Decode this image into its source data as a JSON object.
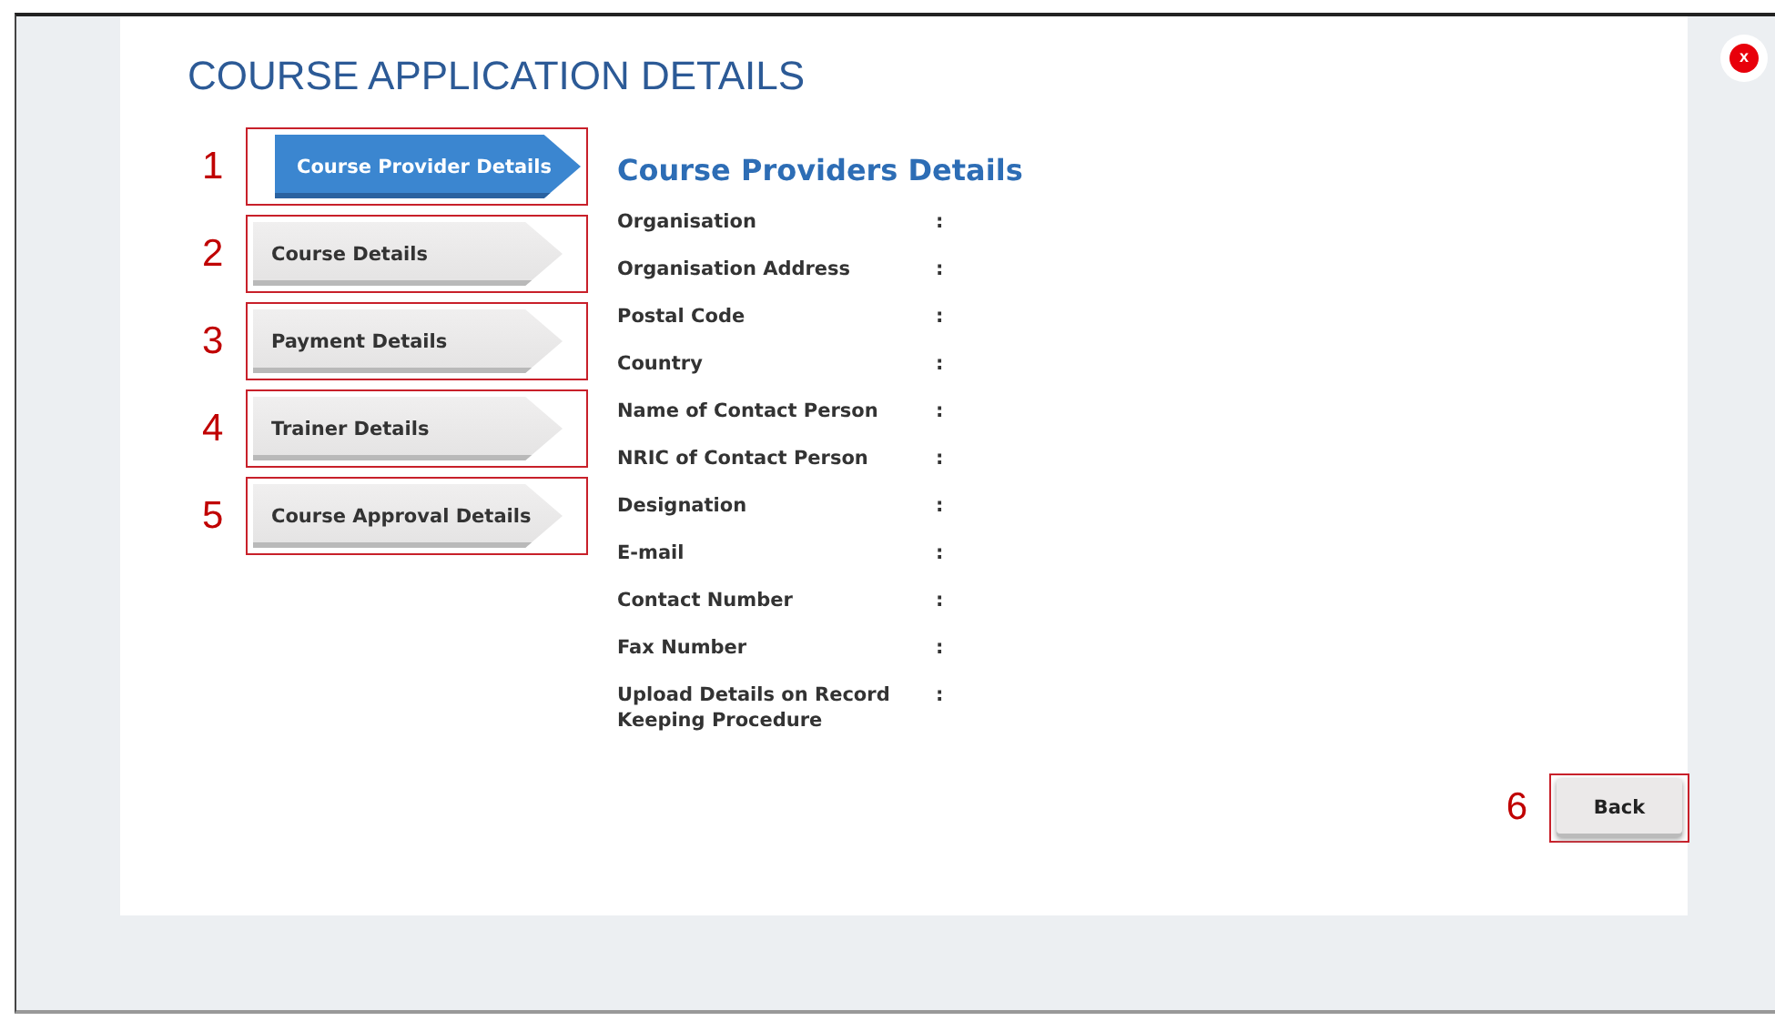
{
  "close_button": {
    "label": "x"
  },
  "title": "COURSE APPLICATION DETAILS",
  "steps": [
    {
      "callout": "1",
      "label": "Course Provider Details",
      "selected": true
    },
    {
      "callout": "2",
      "label": "Course Details",
      "selected": false
    },
    {
      "callout": "3",
      "label": "Payment Details",
      "selected": false
    },
    {
      "callout": "4",
      "label": "Trainer Details",
      "selected": false
    },
    {
      "callout": "5",
      "label": "Course Approval Details",
      "selected": false
    }
  ],
  "section": {
    "heading": "Course Providers Details",
    "fields": [
      {
        "label": "Organisation",
        "separator": ":"
      },
      {
        "label": "Organisation Address",
        "separator": ":"
      },
      {
        "label": "Postal Code",
        "separator": ":"
      },
      {
        "label": "Country",
        "separator": ":"
      },
      {
        "label": "Name of Contact Person",
        "separator": ":"
      },
      {
        "label": "NRIC of Contact Person",
        "separator": ":"
      },
      {
        "label": "Designation",
        "separator": ":"
      },
      {
        "label": "E-mail",
        "separator": ":"
      },
      {
        "label": "Contact Number",
        "separator": ":"
      },
      {
        "label": "Fax Number",
        "separator": ":"
      },
      {
        "label": "Upload Details on Record Keeping Procedure",
        "separator": ":"
      }
    ]
  },
  "back_button": {
    "callout": "6",
    "label": "Back"
  }
}
